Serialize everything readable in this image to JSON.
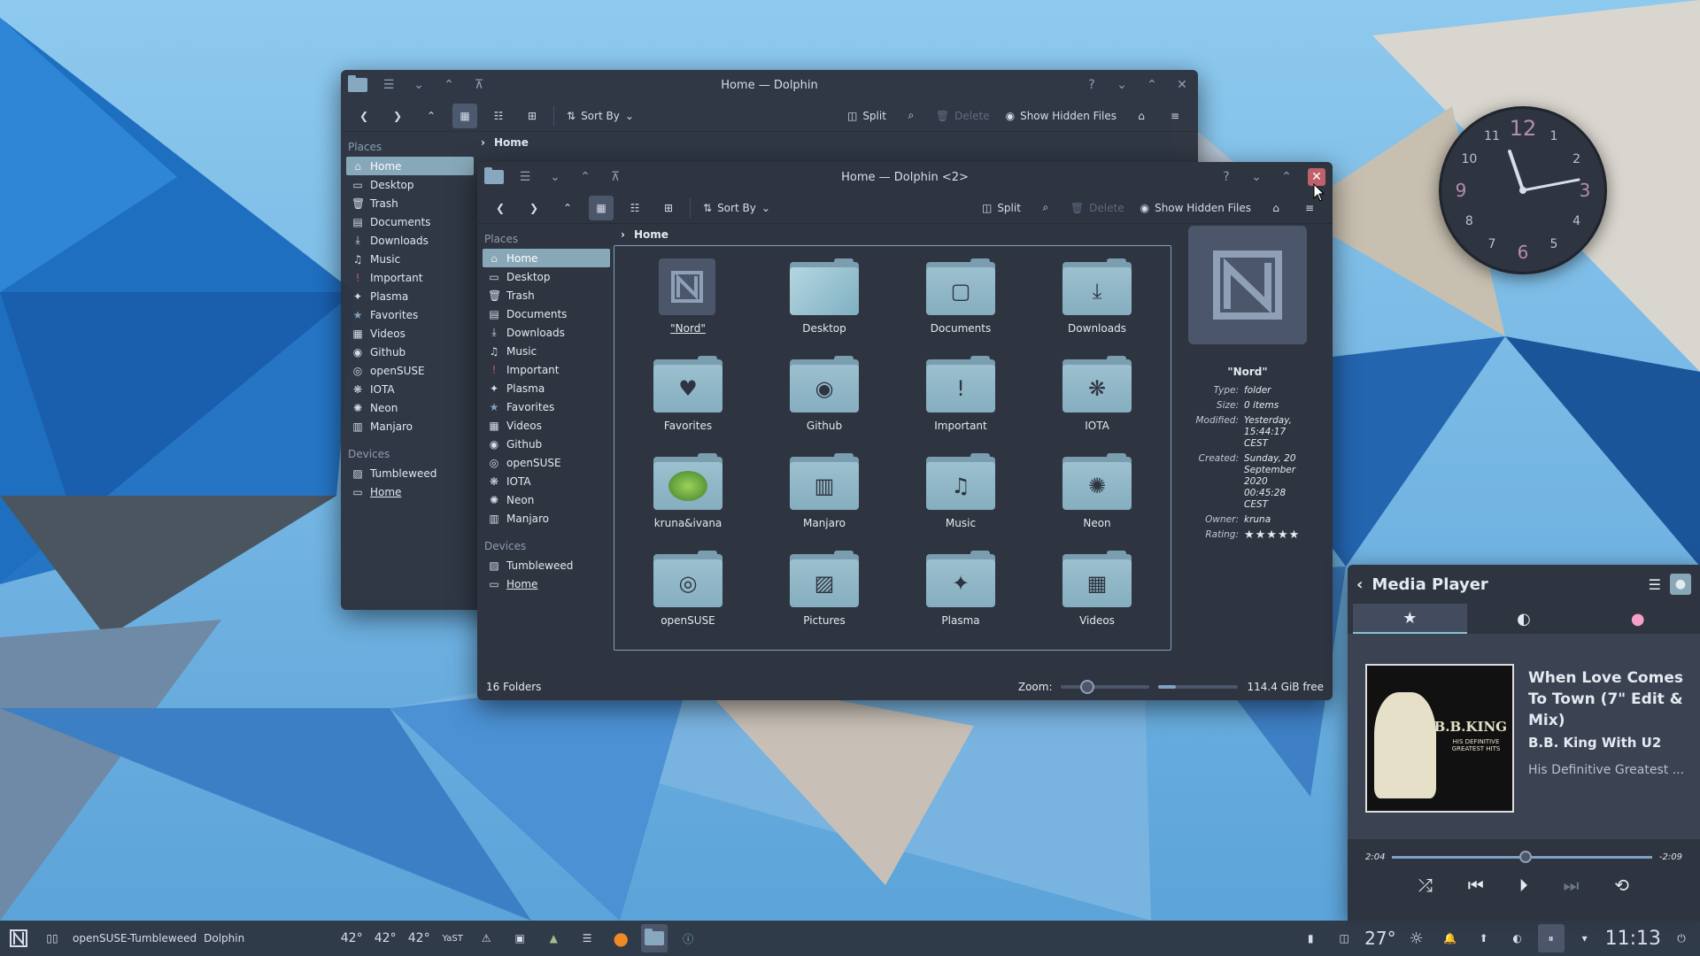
{
  "colors": {
    "accent": "#88c0d0",
    "window_bg": "#2e3440",
    "selection": "#88a8b8",
    "close_red": "#bf616a"
  },
  "back_window": {
    "title": "Home — Dolphin",
    "toolbar": {
      "sort_by": "Sort By",
      "split": "Split",
      "delete": "Delete",
      "show_hidden": "Show Hidden Files"
    },
    "breadcrumb": "Home",
    "places_header": "Places",
    "places": [
      {
        "label": "Home",
        "icon": "home-icon"
      },
      {
        "label": "Desktop",
        "icon": "desktop-icon"
      },
      {
        "label": "Trash",
        "icon": "trash-icon"
      },
      {
        "label": "Documents",
        "icon": "documents-icon"
      },
      {
        "label": "Downloads",
        "icon": "downloads-icon"
      },
      {
        "label": "Music",
        "icon": "music-icon"
      },
      {
        "label": "Important",
        "icon": "important-icon"
      },
      {
        "label": "Plasma",
        "icon": "plasma-icon"
      },
      {
        "label": "Favorites",
        "icon": "star-icon"
      },
      {
        "label": "Videos",
        "icon": "videos-icon"
      },
      {
        "label": "Github",
        "icon": "github-icon"
      },
      {
        "label": "openSUSE",
        "icon": "opensuse-icon"
      },
      {
        "label": "IOTA",
        "icon": "iota-icon"
      },
      {
        "label": "Neon",
        "icon": "neon-icon"
      },
      {
        "label": "Manjaro",
        "icon": "manjaro-icon"
      }
    ],
    "devices_header": "Devices",
    "devices": [
      {
        "label": "Tumbleweed"
      },
      {
        "label": "Home"
      }
    ]
  },
  "front_window": {
    "title": "Home — Dolphin <2>",
    "toolbar": {
      "sort_by": "Sort By",
      "split": "Split",
      "delete": "Delete",
      "show_hidden": "Show Hidden Files"
    },
    "breadcrumb": "Home",
    "places_header": "Places",
    "places": [
      {
        "label": "Home"
      },
      {
        "label": "Desktop"
      },
      {
        "label": "Trash"
      },
      {
        "label": "Documents"
      },
      {
        "label": "Downloads"
      },
      {
        "label": "Music"
      },
      {
        "label": "Important"
      },
      {
        "label": "Plasma"
      },
      {
        "label": "Favorites"
      },
      {
        "label": "Videos"
      },
      {
        "label": "Github"
      },
      {
        "label": "openSUSE"
      },
      {
        "label": "IOTA"
      },
      {
        "label": "Neon"
      },
      {
        "label": "Manjaro"
      }
    ],
    "devices_header": "Devices",
    "devices": [
      {
        "label": "Tumbleweed"
      },
      {
        "label": "Home"
      }
    ],
    "folders": [
      {
        "label": "\"Nord\"",
        "icon": "nord-logo-icon"
      },
      {
        "label": "Desktop",
        "icon": "desktop-folder-icon"
      },
      {
        "label": "Documents",
        "icon": "documents-folder-icon"
      },
      {
        "label": "Downloads",
        "icon": "downloads-folder-icon"
      },
      {
        "label": "Favorites",
        "icon": "heart-folder-icon"
      },
      {
        "label": "Github",
        "icon": "github-folder-icon"
      },
      {
        "label": "Important",
        "icon": "important-folder-icon"
      },
      {
        "label": "IOTA",
        "icon": "iota-folder-icon"
      },
      {
        "label": "kruna&ivana",
        "icon": "chameleon-icon"
      },
      {
        "label": "Manjaro",
        "icon": "manjaro-folder-icon"
      },
      {
        "label": "Music",
        "icon": "music-folder-icon"
      },
      {
        "label": "Neon",
        "icon": "neon-folder-icon"
      },
      {
        "label": "openSUSE",
        "icon": "opensuse-folder-icon"
      },
      {
        "label": "Pictures",
        "icon": "pictures-folder-icon"
      },
      {
        "label": "Plasma",
        "icon": "plasma-folder-icon"
      },
      {
        "label": "Videos",
        "icon": "videos-folder-icon"
      }
    ],
    "info": {
      "name": "\"Nord\"",
      "type_k": "Type:",
      "type_v": "folder",
      "size_k": "Size:",
      "size_v": "0 items",
      "modified_k": "Modified:",
      "modified_v": "Yesterday, 15:44:17 CEST",
      "created_k": "Created:",
      "created_v": "Sunday, 20 September 2020 00:45:28 CEST",
      "owner_k": "Owner:",
      "owner_v": "kruna",
      "rating_k": "Rating:",
      "rating_v": 5
    },
    "status": {
      "count": "16 Folders",
      "zoom": "Zoom:",
      "free": "114.4 GiB free",
      "zoom_level": 0.3,
      "disk_used": 0.22
    }
  },
  "clock": {
    "time": "11:13",
    "numbers": [
      "12",
      "1",
      "2",
      "3",
      "4",
      "5",
      "6",
      "7",
      "8",
      "9",
      "10",
      "11"
    ]
  },
  "media": {
    "header": "Media Player",
    "title": "When Love Comes To Town (7\" Edit & Mix)",
    "artist": "B.B. King With U2",
    "album": "His Definitive Greatest ...",
    "cover_text": "B.B.KING",
    "cover_sub": "HIS DEFINITIVE GREATEST HITS",
    "elapsed": "2:04",
    "remaining": "-2:09",
    "progress": 0.49
  },
  "taskbar": {
    "distro": "openSUSE-Tumbleweed",
    "app": "Dolphin",
    "temps": [
      "42°",
      "42°",
      "42°"
    ],
    "yast": "YaST",
    "weather": "27°",
    "time": "11:13"
  }
}
